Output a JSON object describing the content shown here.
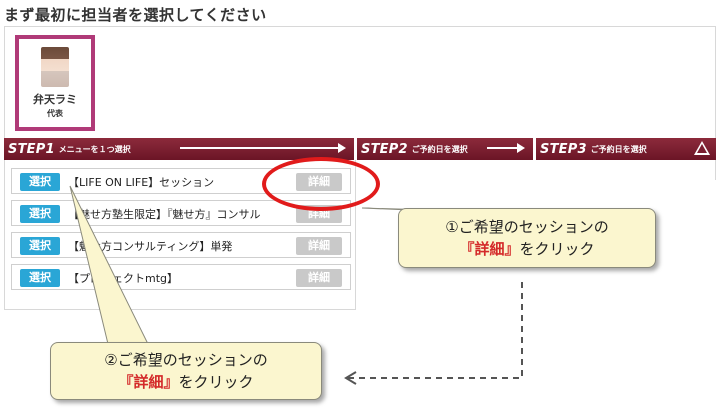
{
  "page_title": "まず最初に担当者を選択してください",
  "staff": [
    {
      "name": "弁天ラミ",
      "role": "代表"
    }
  ],
  "steps": [
    {
      "num": "STEP1",
      "label": "メニューを１つ選択"
    },
    {
      "num": "STEP2",
      "label": "ご予約日を選択"
    },
    {
      "num": "STEP3",
      "label": "ご予約日を選択"
    }
  ],
  "menu": {
    "select_label": "選択",
    "detail_label": "詳細",
    "items": [
      {
        "name": "【LIFE ON LIFE】セッション"
      },
      {
        "name": "【魅せ方塾生限定】『魅せ方』コンサル"
      },
      {
        "name": "【魅せ方コンサルティング】単発"
      },
      {
        "name": "【プロジェクトmtg】"
      }
    ]
  },
  "callouts": [
    {
      "line1": "①ご希望のセッションの",
      "highlight": "『詳細』",
      "rest": "をクリック"
    },
    {
      "line1": "②ご希望のセッションの",
      "highlight": "『詳細』",
      "rest": "をクリック"
    }
  ],
  "colors": {
    "step_bar": "#7b1e30",
    "select_button": "#2aa6d6",
    "detail_button": "#c9c9c9",
    "staff_border": "#b03a78",
    "highlight_ring": "#e11b1b",
    "callout_fill": "#fbf6cf"
  }
}
